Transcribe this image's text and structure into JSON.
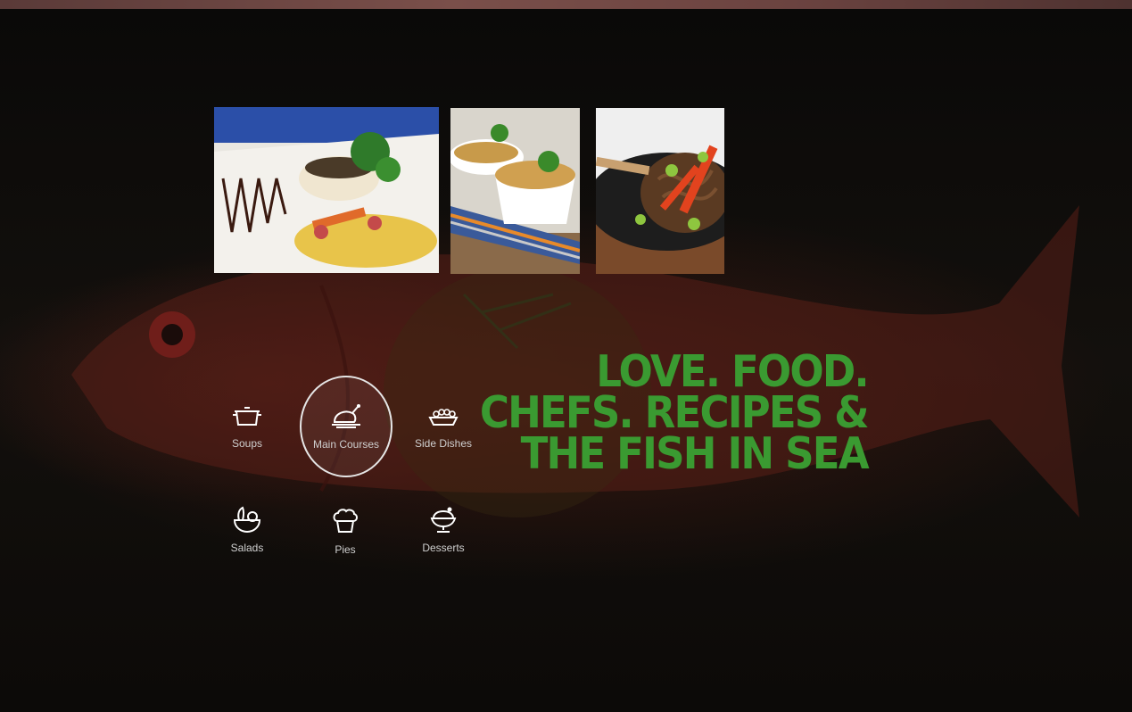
{
  "gallery": {
    "photos": [
      {
        "icon": "fish-dish-photo"
      },
      {
        "icon": "curry-bowls-photo"
      },
      {
        "icon": "noodles-pan-photo"
      }
    ]
  },
  "categories": [
    {
      "label": "Soups",
      "icon": "pot-icon",
      "active": false
    },
    {
      "label": "Main Courses",
      "icon": "roast-chicken-icon",
      "active": true
    },
    {
      "label": "Side Dishes",
      "icon": "side-dish-icon",
      "active": false
    },
    {
      "label": "Salads",
      "icon": "salad-bowl-icon",
      "active": false
    },
    {
      "label": "Pies",
      "icon": "pie-icon",
      "active": false
    },
    {
      "label": "Desserts",
      "icon": "dessert-cup-icon",
      "active": false
    }
  ],
  "headline": {
    "line1": "LOVE. FOOD.",
    "line2": "CHEFS. RECIPES &",
    "line3": "THE FISH IN SEA"
  },
  "colors": {
    "headline": "#3a9a31",
    "label": "#cfcfcf",
    "active_ring": "#e6e6e6",
    "background": "#0d0b09"
  }
}
